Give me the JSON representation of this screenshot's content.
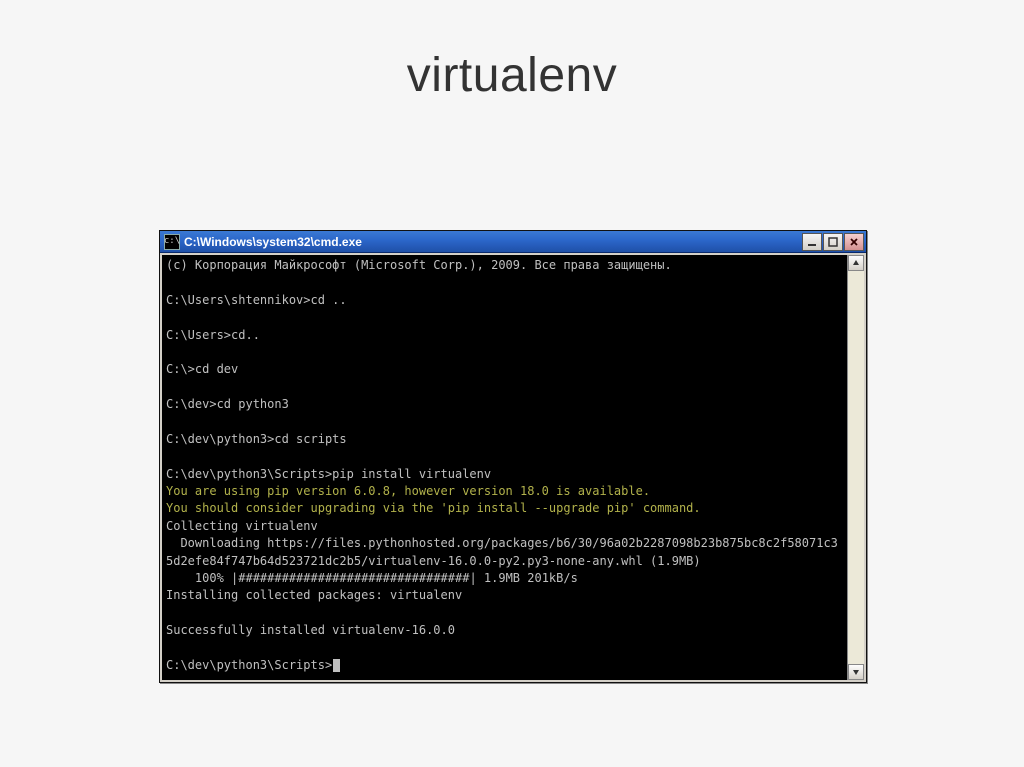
{
  "slide": {
    "title": "virtualenv"
  },
  "window": {
    "title": "C:\\Windows\\system32\\cmd.exe",
    "icon_glyph": "c:\\"
  },
  "terminal": {
    "lines": [
      {
        "text": "(c) Корпорация Майкрософт (Microsoft Corp.), 2009. Все права защищены.",
        "cls": ""
      },
      {
        "text": "",
        "cls": "blank"
      },
      {
        "text": "C:\\Users\\shtennikov>cd ..",
        "cls": ""
      },
      {
        "text": "",
        "cls": "blank"
      },
      {
        "text": "C:\\Users>cd..",
        "cls": ""
      },
      {
        "text": "",
        "cls": "blank"
      },
      {
        "text": "C:\\>cd dev",
        "cls": ""
      },
      {
        "text": "",
        "cls": "blank"
      },
      {
        "text": "C:\\dev>cd python3",
        "cls": ""
      },
      {
        "text": "",
        "cls": "blank"
      },
      {
        "text": "C:\\dev\\python3>cd scripts",
        "cls": ""
      },
      {
        "text": "",
        "cls": "blank"
      },
      {
        "text": "C:\\dev\\python3\\Scripts>pip install virtualenv",
        "cls": ""
      },
      {
        "text": "You are using pip version 6.0.8, however version 18.0 is available.",
        "cls": "warn"
      },
      {
        "text": "You should consider upgrading via the 'pip install --upgrade pip' command.",
        "cls": "warn"
      },
      {
        "text": "Collecting virtualenv",
        "cls": ""
      },
      {
        "text": "  Downloading https://files.pythonhosted.org/packages/b6/30/96a02b2287098b23b875bc8c2f58071c35d2efe84f747b64d523721dc2b5/virtualenv-16.0.0-py2.py3-none-any.whl (1.9MB)",
        "cls": ""
      },
      {
        "text": "    100% |################################| 1.9MB 201kB/s",
        "cls": ""
      },
      {
        "text": "Installing collected packages: virtualenv",
        "cls": ""
      },
      {
        "text": "",
        "cls": "blank"
      },
      {
        "text": "Successfully installed virtualenv-16.0.0",
        "cls": ""
      },
      {
        "text": "",
        "cls": "blank"
      }
    ],
    "prompt": "C:\\dev\\python3\\Scripts>"
  }
}
